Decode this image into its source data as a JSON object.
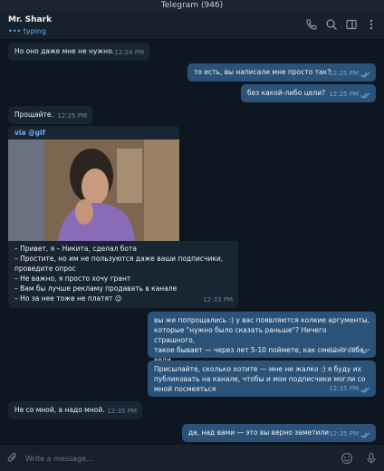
{
  "window": {
    "title": "Telegram (946)"
  },
  "header": {
    "name": "Mr. Shark",
    "status": "typing",
    "status_dots": "•••"
  },
  "messages": [
    {
      "dir": "in",
      "text": "Но оно даже мне не нужно.",
      "time": "12:24 PM"
    },
    {
      "dir": "out",
      "text": "то есть, вы написали мне просто так?",
      "time": "12:25 PM",
      "read": true
    },
    {
      "dir": "out",
      "text": "без какой-либо цели?",
      "time": "12:25 PM",
      "read": true
    },
    {
      "dir": "in",
      "text": "Прощайте.",
      "time": "12:25 PM"
    },
    {
      "dir": "in",
      "via": "via @gif",
      "lines": [
        "– Привет, я – Никита, сделал бота",
        "– Простите, но им не пользуются даже ваши подписчики,",
        "проведите опрос",
        "– Не важно, я просто хочу грант",
        "– Вам бы лучше рекламу продавать в канале",
        "– Но за нее тоже не платят 😉"
      ],
      "time": "12:33 PM"
    },
    {
      "dir": "out",
      "lines": [
        "вы же попрощались :) у вас появляются колкие аргументы,",
        "которые \"нужно было сказать раньше\"? Ничего страшного,",
        "такое бывает — через лет 5-10 поймете, как смешно себя вели",
        ":)"
      ],
      "time": "12:34 PM",
      "read": true
    },
    {
      "dir": "out",
      "lines": [
        "Присылайте, сколько хотите — мне не жалко :) я буду их",
        "публиковать на канале, чтобы и мои подписчики могли со",
        "мной посмеяться"
      ],
      "time": "12:35 PM",
      "read": true
    },
    {
      "dir": "in",
      "text": "Не со мной, а надо мной.",
      "time": "12:35 PM"
    },
    {
      "dir": "out",
      "text": "да, над вами — это вы верно заметили",
      "time": "12:35 PM",
      "read": true
    }
  ],
  "composer": {
    "placeholder": "Write a message..."
  },
  "icons": [
    "phone-icon",
    "search-icon",
    "sidebar-icon",
    "more-icon",
    "attach-icon",
    "emoji-icon",
    "microphone-icon",
    "double-check-icon"
  ],
  "colors": {
    "background": "#0e1621",
    "incoming": "#182533",
    "outgoing": "#2b5278",
    "accent": "#6ab2f2"
  }
}
